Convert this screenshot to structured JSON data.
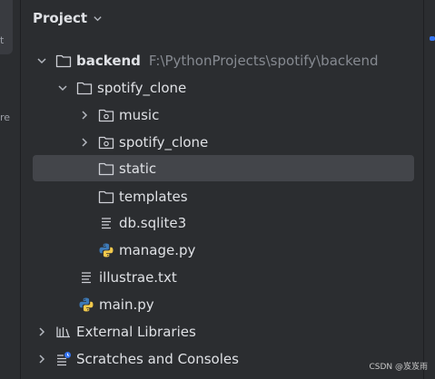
{
  "sidebar": {
    "left_texts": [
      "t",
      "re"
    ]
  },
  "header": {
    "title": "Project"
  },
  "tree": {
    "backend": {
      "label": "backend",
      "path": "F:\\PythonProjects\\spotify\\backend"
    },
    "spotify_clone": {
      "label": "spotify_clone"
    },
    "music": {
      "label": "music"
    },
    "spotify_clone_pkg": {
      "label": "spotify_clone"
    },
    "static": {
      "label": "static"
    },
    "templates": {
      "label": "templates"
    },
    "db": {
      "label": "db.sqlite3"
    },
    "manage": {
      "label": "manage.py"
    },
    "illustrae": {
      "label": "illustrae.txt"
    },
    "main": {
      "label": "main.py"
    },
    "external": {
      "label": "External Libraries"
    },
    "scratches": {
      "label": "Scratches and Consoles"
    }
  },
  "watermark": "CSDN @岌岌雨",
  "colors": {
    "background": "#2b2d30",
    "selection": "#43454a",
    "accent": "#3574f0",
    "python_blue": "#3d7ab8",
    "python_yellow": "#f2c94c"
  }
}
